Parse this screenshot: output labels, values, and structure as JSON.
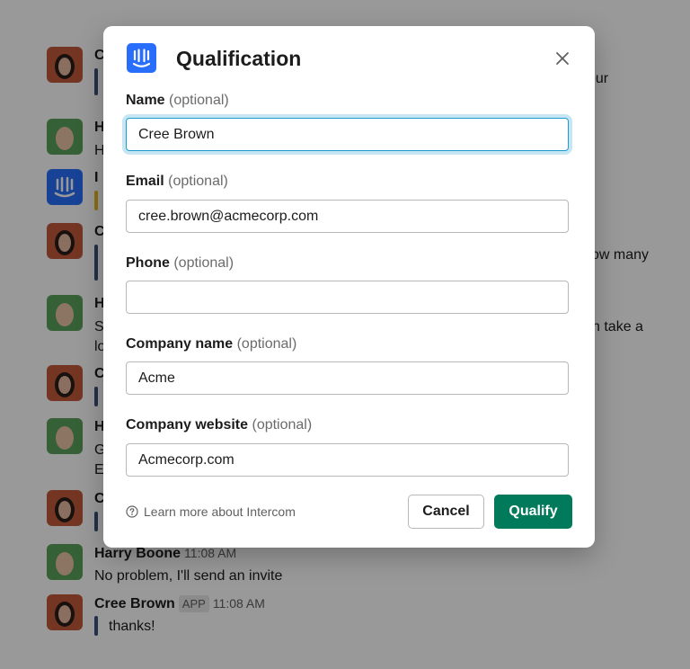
{
  "chat": {
    "messages": [
      {
        "id": "m1",
        "name": "C",
        "text": "",
        "trail": "our"
      },
      {
        "id": "m2",
        "name": "H",
        "text": "H"
      },
      {
        "id": "m3",
        "name": "I",
        "text": ""
      },
      {
        "id": "m4",
        "name": "C",
        "text": "",
        "trail": "ow many"
      },
      {
        "id": "m5",
        "name": "H",
        "text": "S",
        "text2": "lo",
        "trail": "n take a"
      },
      {
        "id": "m6",
        "name": "C",
        "text": ""
      },
      {
        "id": "m7",
        "name": "H",
        "text": "G",
        "text2": "E"
      },
      {
        "id": "m8",
        "name": "C",
        "text": ""
      },
      {
        "id": "m9",
        "name": "Harry Boone",
        "time": "11:08 AM",
        "text": "No problem, I'll send an invite"
      },
      {
        "id": "m10",
        "name": "Cree Brown",
        "badge": "APP",
        "time": "11:08 AM",
        "text": "thanks!"
      }
    ]
  },
  "modal": {
    "title": "Qualification",
    "close_icon": "close-icon",
    "logo_icon": "intercom-logo-icon",
    "optional_text": "(optional)",
    "fields": {
      "name": {
        "label": "Name",
        "value": "Cree Brown",
        "placeholder": ""
      },
      "email": {
        "label": "Email",
        "value": "cree.brown@acmecorp.com",
        "placeholder": ""
      },
      "phone": {
        "label": "Phone",
        "value": "",
        "placeholder": ""
      },
      "company_name": {
        "label": "Company name",
        "value": "Acme",
        "placeholder": ""
      },
      "company_website": {
        "label": "Company website",
        "value": "Acmecorp.com",
        "placeholder": ""
      }
    },
    "learn_more": "Learn more about Intercom",
    "cancel_label": "Cancel",
    "qualify_label": "Qualify"
  },
  "colors": {
    "accent": "#1d9bd1",
    "primary_button": "#007a5a",
    "intercom_blue": "#286efa",
    "overlay": "#000000"
  }
}
